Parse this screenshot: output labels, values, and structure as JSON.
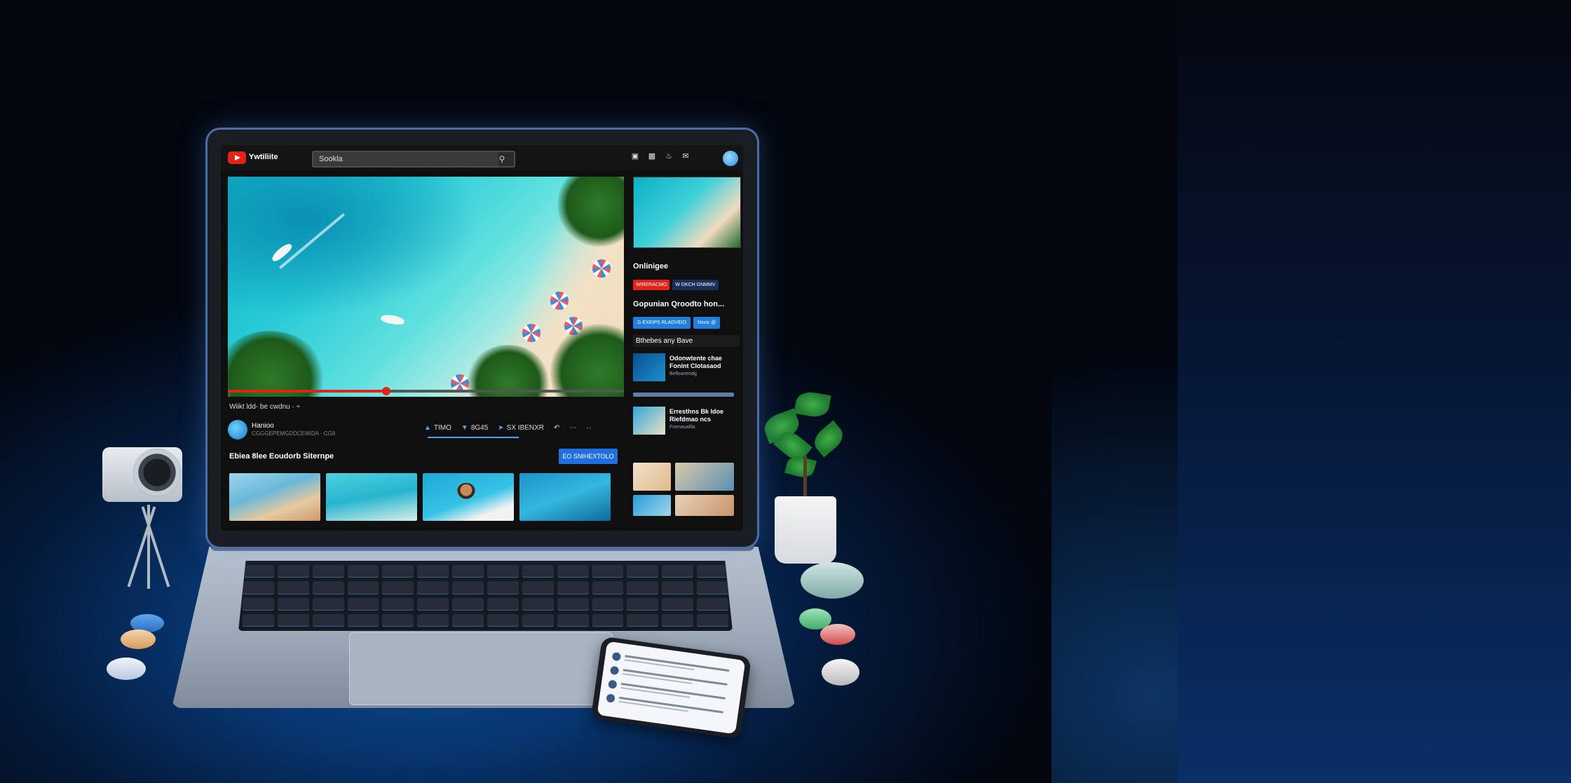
{
  "header": {
    "logo_text": "Ywtiliite",
    "search_value": "Sookla",
    "icons": [
      "video-camera-icon",
      "apps-icon",
      "bell-icon",
      "messages-icon"
    ]
  },
  "player": {
    "progress_percent": 40,
    "video_title": "Wiikt ldd- be cwdnu · ÷"
  },
  "channel": {
    "name": "Hanioo",
    "subtitle": "CGGGEPEMGDDCEMIDA · CG8",
    "likes": "TIMO",
    "dislikes": "8G45",
    "share": "SX IBENXR"
  },
  "related": {
    "title": "Ebiea 8lee Eoudorb Siternpe",
    "subscribe_label": "ΕΟ SNIHEXTOLO"
  },
  "sidebar": {
    "heading1": "Onlinigee",
    "badge_red": "WIRERACMO",
    "badge_dark": "W DKCH GNMMV",
    "heading2": "Gopunian Qroodto hon...",
    "btn_primary": "G EXEIPS RLADVEIO",
    "btn_secondary": "Nsvic @",
    "heading3": "Bthebes any Bave",
    "items": [
      {
        "line1": "Odonwtente chae",
        "line2": "Fonint Clotasaod",
        "meta": "Belloanendg"
      },
      {
        "line1": "Erresthns Bk ldoe",
        "line2": "Riefdmao ncs",
        "meta": "Fnenaualtla"
      }
    ]
  },
  "colors": {
    "accent_red": "#e62117",
    "accent_blue": "#1f6fe0",
    "screen_bg": "#0f0f10"
  }
}
